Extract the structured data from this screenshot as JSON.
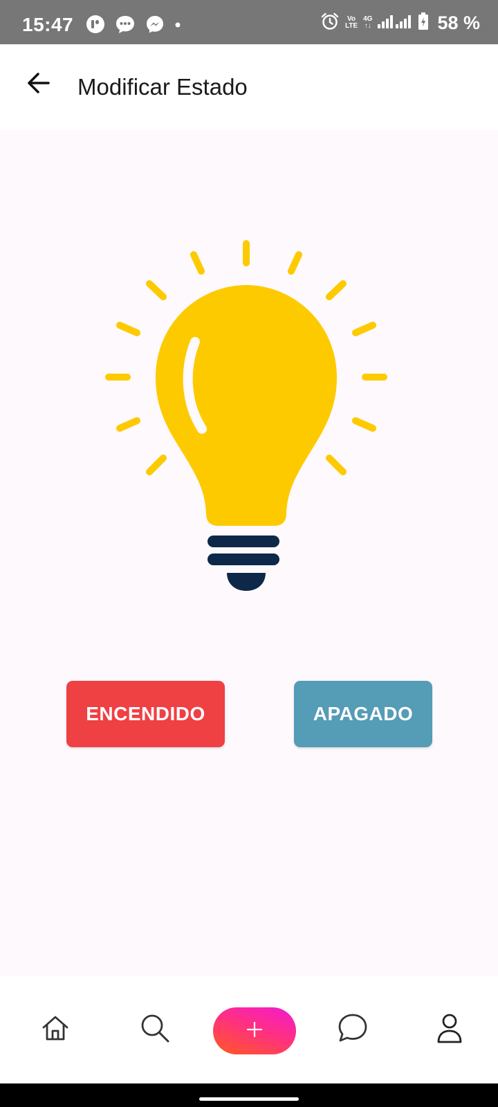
{
  "status_bar": {
    "time": "15:47",
    "battery": "58 %",
    "network_label_top": "Vo",
    "network_label_bottom": "LTE",
    "data_label_top": "4G",
    "data_label_bottom": "↑↓",
    "left_icons": [
      "r-app-icon",
      "messages-icon",
      "messenger-icon",
      "notification-dot-icon"
    ],
    "right_icons": [
      "alarm-icon",
      "signal-icon",
      "battery-icon"
    ]
  },
  "app_bar": {
    "title": "Modificar Estado",
    "back_icon": "arrow-left-icon"
  },
  "main": {
    "bulb_icon": "lightbulb-icon",
    "colors": {
      "bulb": "#fdca00",
      "base": "#0d2848",
      "rays": "#fdca00"
    },
    "buttons": {
      "on_label": "ENCENDIDO",
      "off_label": "APAGADO",
      "on_color": "#ef4044",
      "off_color": "#559cb6"
    }
  },
  "bottom_nav": {
    "items": [
      {
        "icon": "home-icon"
      },
      {
        "icon": "search-icon"
      },
      {
        "icon": "add-icon"
      },
      {
        "icon": "chat-icon"
      },
      {
        "icon": "profile-icon"
      }
    ],
    "fab_symbol": "+"
  }
}
